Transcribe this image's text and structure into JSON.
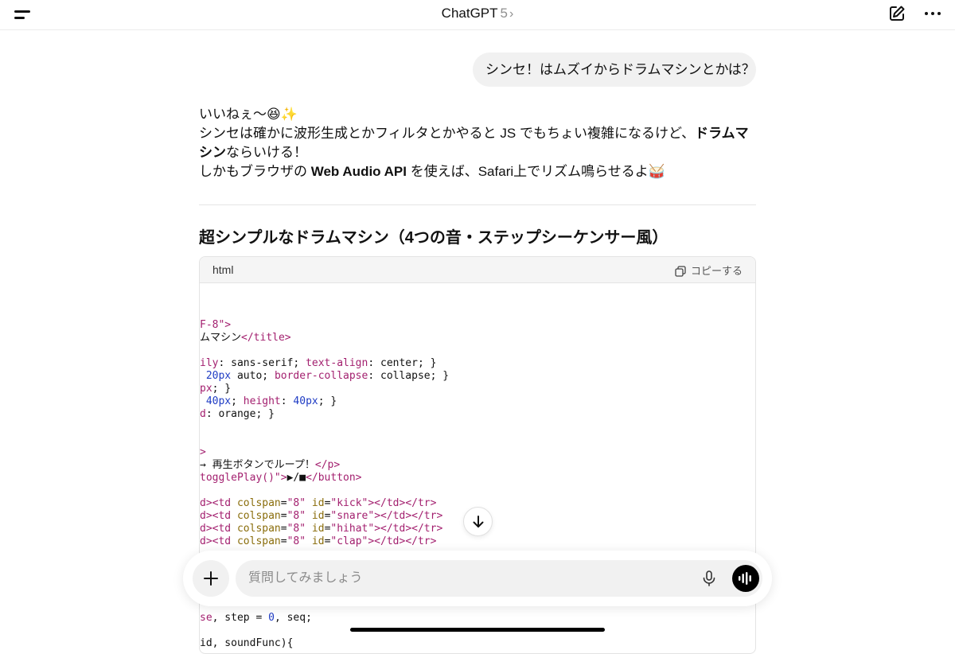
{
  "header": {
    "title": "ChatGPT",
    "version": "5",
    "chevron": "›",
    "icons": [
      "menu-icon",
      "compose-icon",
      "more-icon"
    ]
  },
  "conversation": {
    "user_message": "シンセ！はムズイからドラムマシンとかは？",
    "assistant": {
      "line1": "いいねぇ〜😆✨",
      "line2_a": "シンセは確かに波形生成とかフィルタとかやると JS でもちょい複雑になるけど、",
      "line2_bold": "ドラムマシン",
      "line2_b": "ならいける！",
      "line3_a": "しかもブラウザの ",
      "line3_bold": "Web Audio API",
      "line3_b": " を使えば、Safari上でリズム鳴らせるよ🥁"
    },
    "section_heading": "超シンプルなドラムマシン（4つの音・ステップシーケンサー風）",
    "code_block": {
      "language": "html",
      "copy_label": "コピーする",
      "lines": [
        [
          {
            "t": "tag",
            "v": "F-8\">"
          }
        ],
        [
          {
            "t": "txt",
            "v": "ムマシン"
          },
          {
            "t": "tag",
            "v": "</title>"
          }
        ],
        [
          {
            "t": "txt",
            "v": ""
          }
        ],
        [
          {
            "t": "prop",
            "v": "ily"
          },
          {
            "t": "txt",
            "v": ": sans-serif; "
          },
          {
            "t": "prop",
            "v": "text-align"
          },
          {
            "t": "txt",
            "v": ": center; }"
          }
        ],
        [
          {
            "t": "txt",
            "v": " "
          },
          {
            "t": "num",
            "v": "20px"
          },
          {
            "t": "txt",
            "v": " auto; "
          },
          {
            "t": "prop",
            "v": "border-collapse"
          },
          {
            "t": "txt",
            "v": ": collapse; }"
          }
        ],
        [
          {
            "t": "prop",
            "v": "px"
          },
          {
            "t": "txt",
            "v": "; }"
          }
        ],
        [
          {
            "t": "txt",
            "v": " "
          },
          {
            "t": "num",
            "v": "40px"
          },
          {
            "t": "txt",
            "v": "; "
          },
          {
            "t": "prop",
            "v": "height"
          },
          {
            "t": "txt",
            "v": ": "
          },
          {
            "t": "num",
            "v": "40px"
          },
          {
            "t": "txt",
            "v": "; }"
          }
        ],
        [
          {
            "t": "prop",
            "v": "d"
          },
          {
            "t": "txt",
            "v": ": orange; }"
          }
        ],
        [
          {
            "t": "txt",
            "v": ""
          }
        ],
        [
          {
            "t": "txt",
            "v": ""
          }
        ],
        [
          {
            "t": "tag",
            "v": ">"
          }
        ],
        [
          {
            "t": "txt",
            "v": "→ 再生ボタンでループ！"
          },
          {
            "t": "tag",
            "v": "</p>"
          }
        ],
        [
          {
            "t": "str",
            "v": "togglePlay()\""
          },
          {
            "t": "tag",
            "v": ">"
          },
          {
            "t": "txt",
            "v": "▶/■"
          },
          {
            "t": "tag",
            "v": "</button>"
          }
        ],
        [
          {
            "t": "txt",
            "v": ""
          }
        ],
        [
          {
            "t": "tag",
            "v": "d><td "
          },
          {
            "t": "attr",
            "v": "colspan"
          },
          {
            "t": "txt",
            "v": "="
          },
          {
            "t": "str",
            "v": "\"8\""
          },
          {
            "t": "txt",
            "v": " "
          },
          {
            "t": "attr",
            "v": "id"
          },
          {
            "t": "txt",
            "v": "="
          },
          {
            "t": "str",
            "v": "\"kick\""
          },
          {
            "t": "tag",
            "v": "></td></tr>"
          }
        ],
        [
          {
            "t": "tag",
            "v": "d><td "
          },
          {
            "t": "attr",
            "v": "colspan"
          },
          {
            "t": "txt",
            "v": "="
          },
          {
            "t": "str",
            "v": "\"8\""
          },
          {
            "t": "txt",
            "v": " "
          },
          {
            "t": "attr",
            "v": "id"
          },
          {
            "t": "txt",
            "v": "="
          },
          {
            "t": "str",
            "v": "\"snare\""
          },
          {
            "t": "tag",
            "v": "></td></tr>"
          }
        ],
        [
          {
            "t": "tag",
            "v": "d><td "
          },
          {
            "t": "attr",
            "v": "colspan"
          },
          {
            "t": "txt",
            "v": "="
          },
          {
            "t": "str",
            "v": "\"8\""
          },
          {
            "t": "txt",
            "v": " "
          },
          {
            "t": "attr",
            "v": "id"
          },
          {
            "t": "txt",
            "v": "="
          },
          {
            "t": "str",
            "v": "\"hihat\""
          },
          {
            "t": "tag",
            "v": "></td></tr>"
          }
        ],
        [
          {
            "t": "tag",
            "v": "d><td "
          },
          {
            "t": "attr",
            "v": "colspan"
          },
          {
            "t": "txt",
            "v": "="
          },
          {
            "t": "str",
            "v": "\"8\""
          },
          {
            "t": "txt",
            "v": " "
          },
          {
            "t": "attr",
            "v": "id"
          },
          {
            "t": "txt",
            "v": "="
          },
          {
            "t": "str",
            "v": "\"clap\""
          },
          {
            "t": "tag",
            "v": "></td></tr>"
          }
        ],
        [
          {
            "t": "txt",
            "v": ""
          }
        ],
        [
          {
            "t": "txt",
            "v": ""
          }
        ],
        [
          {
            "t": "txt",
            "v": ""
          }
        ],
        [
          {
            "t": "txt",
            "v": ""
          }
        ],
        [
          {
            "t": "txt",
            "v": ""
          }
        ],
        [
          {
            "t": "prop",
            "v": "se"
          },
          {
            "t": "txt",
            "v": ", step = "
          },
          {
            "t": "num",
            "v": "0"
          },
          {
            "t": "txt",
            "v": ", seq;"
          }
        ],
        [
          {
            "t": "txt",
            "v": ""
          }
        ],
        [
          {
            "t": "txt",
            "v": "id, soundFunc){"
          }
        ]
      ]
    }
  },
  "composer": {
    "placeholder": "質問してみましょう",
    "icons": [
      "plus-icon",
      "microphone-icon",
      "voice-mode-icon"
    ]
  },
  "scroll_button": {
    "icon": "arrow-down-icon"
  }
}
